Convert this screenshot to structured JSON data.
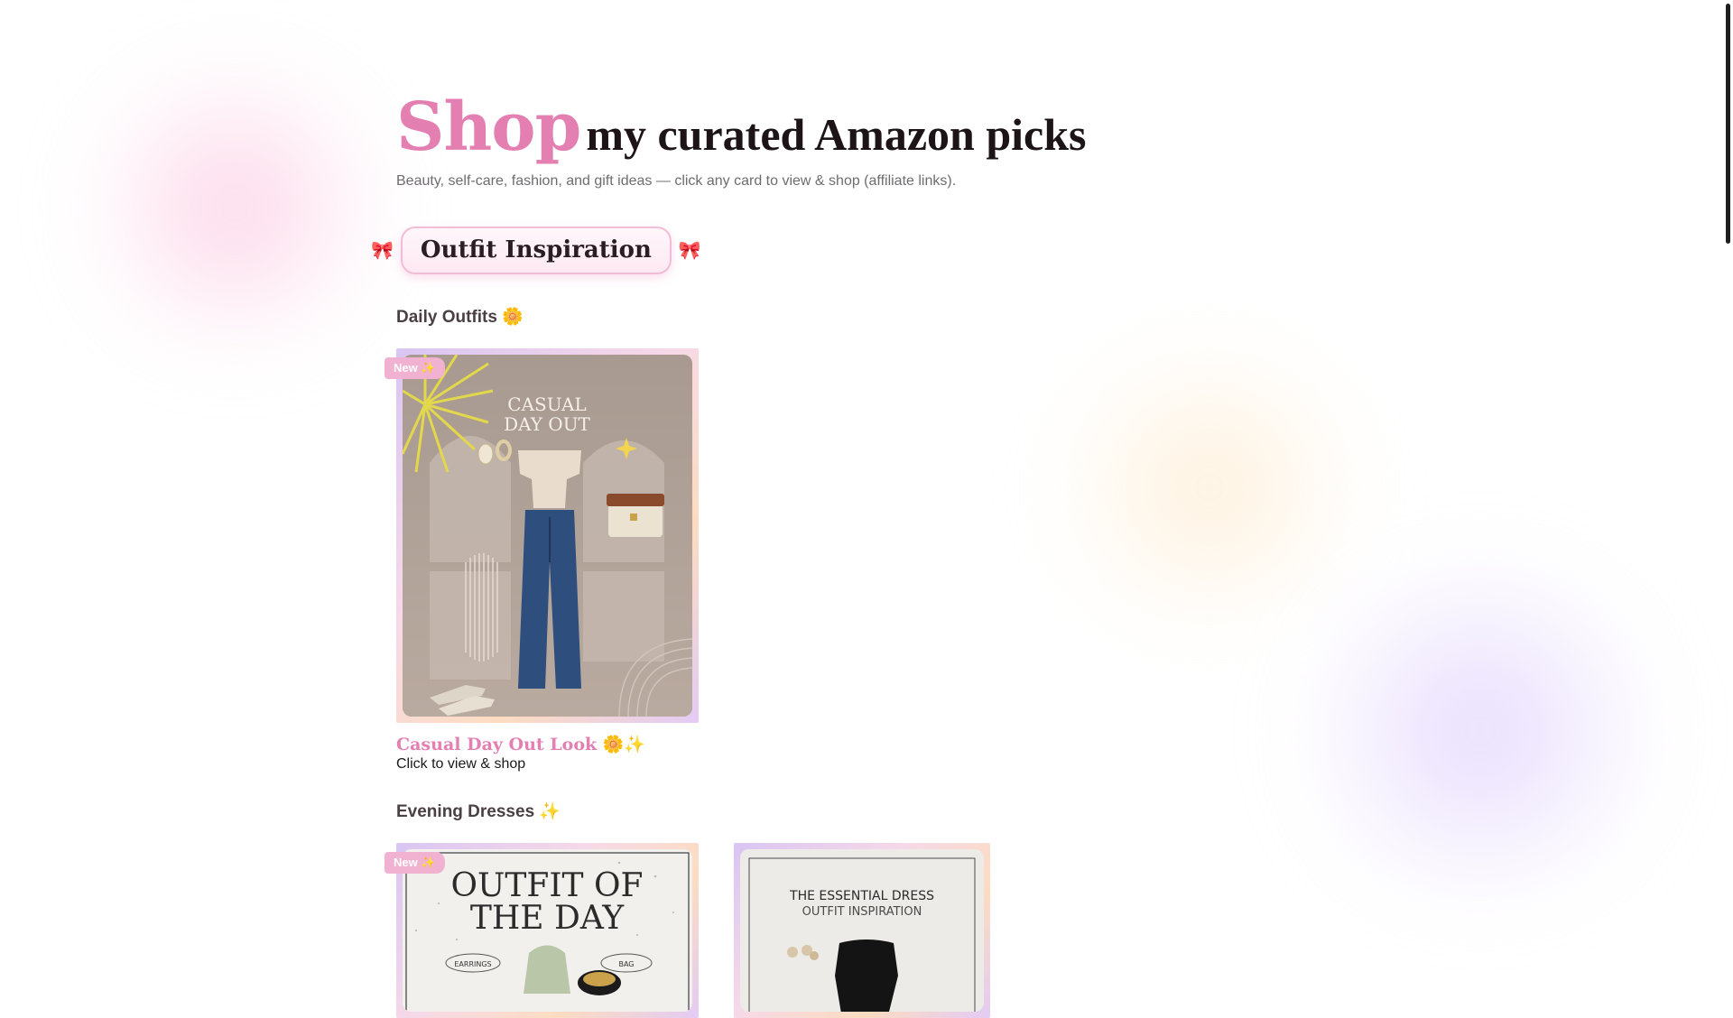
{
  "header": {
    "shop_word": "Shop",
    "title_rest": "my curated Amazon picks",
    "subtitle": "Beauty, self-care, fashion, and gift ideas — click any card to view & shop (affiliate links)."
  },
  "section": {
    "title": "Outfit Inspiration",
    "bow_left": "🎀",
    "bow_right": "🎀"
  },
  "daily": {
    "heading": "Daily Outfits 🌼",
    "card": {
      "badge": "New ✨",
      "image_text_line1": "CASUAL",
      "image_text_line2": "DAY OUT",
      "title": "Casual Day Out Look 🌼✨",
      "cta": "Click to view & shop"
    }
  },
  "evening": {
    "heading": "Evening Dresses ✨",
    "cards": [
      {
        "badge": "New ✨",
        "image_text_line1": "OUTFIT OF",
        "image_text_line2": "THE DAY",
        "tag_left": "EARRINGS",
        "tag_right": "BAG"
      },
      {
        "image_text_line1": "THE ESSENTIAL DRESS",
        "image_text_line2": "OUTFIT INSPIRATION"
      }
    ]
  },
  "colors": {
    "accent_pink": "#e47fb2",
    "badge_pink": "#f1b2d1",
    "heading_dark": "#1c1416",
    "muted_text": "#6f6c70"
  }
}
